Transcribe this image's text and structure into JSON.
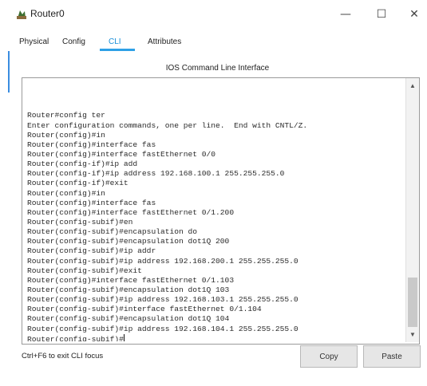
{
  "window": {
    "title": "Router0",
    "minimize_glyph": "—",
    "maximize_glyph": "☐",
    "close_glyph": "✕",
    "icon": "router-icon"
  },
  "tabs": [
    {
      "label": "Physical",
      "active": false
    },
    {
      "label": "Config",
      "active": false
    },
    {
      "label": "CLI",
      "active": true
    },
    {
      "label": "Attributes",
      "active": false
    }
  ],
  "cli": {
    "header": "IOS Command Line Interface",
    "lines": [
      "Router#config ter",
      "Enter configuration commands, one per line.  End with CNTL/Z.",
      "Router(config)#in",
      "Router(config)#interface fas",
      "Router(config)#interface fastEthernet 0/0",
      "Router(config-if)#ip add",
      "Router(config-if)#ip address 192.168.100.1 255.255.255.0",
      "Router(config-if)#exit",
      "Router(config)#in",
      "Router(config)#interface fas",
      "Router(config)#interface fastEthernet 0/1.200",
      "Router(config-subif)#en",
      "Router(config-subif)#encapsulation do",
      "Router(config-subif)#encapsulation dot1Q 200",
      "Router(config-subif)#ip addr",
      "Router(config-subif)#ip address 192.168.200.1 255.255.255.0",
      "Router(config-subif)#exit",
      "Router(config)#interface fastEthernet 0/1.103",
      "Router(config-subif)#encapsulation dot1Q 103",
      "Router(config-subif)#ip address 192.168.103.1 255.255.255.0",
      "Router(config-subif)#interface fastEthernet 0/1.104",
      "Router(config-subif)#encapsulation dot1Q 104",
      "Router(config-subif)#ip address 192.168.104.1 255.255.255.0"
    ],
    "current_prompt": "Router(config-subif)#",
    "scroll_up_glyph": "▲",
    "scroll_down_glyph": "▼"
  },
  "footer": {
    "hint": "Ctrl+F6 to exit CLI focus",
    "copy_label": "Copy",
    "paste_label": "Paste"
  },
  "colors": {
    "active_tab": "#1a8fd8",
    "tab_underline": "#2ea0e6"
  }
}
